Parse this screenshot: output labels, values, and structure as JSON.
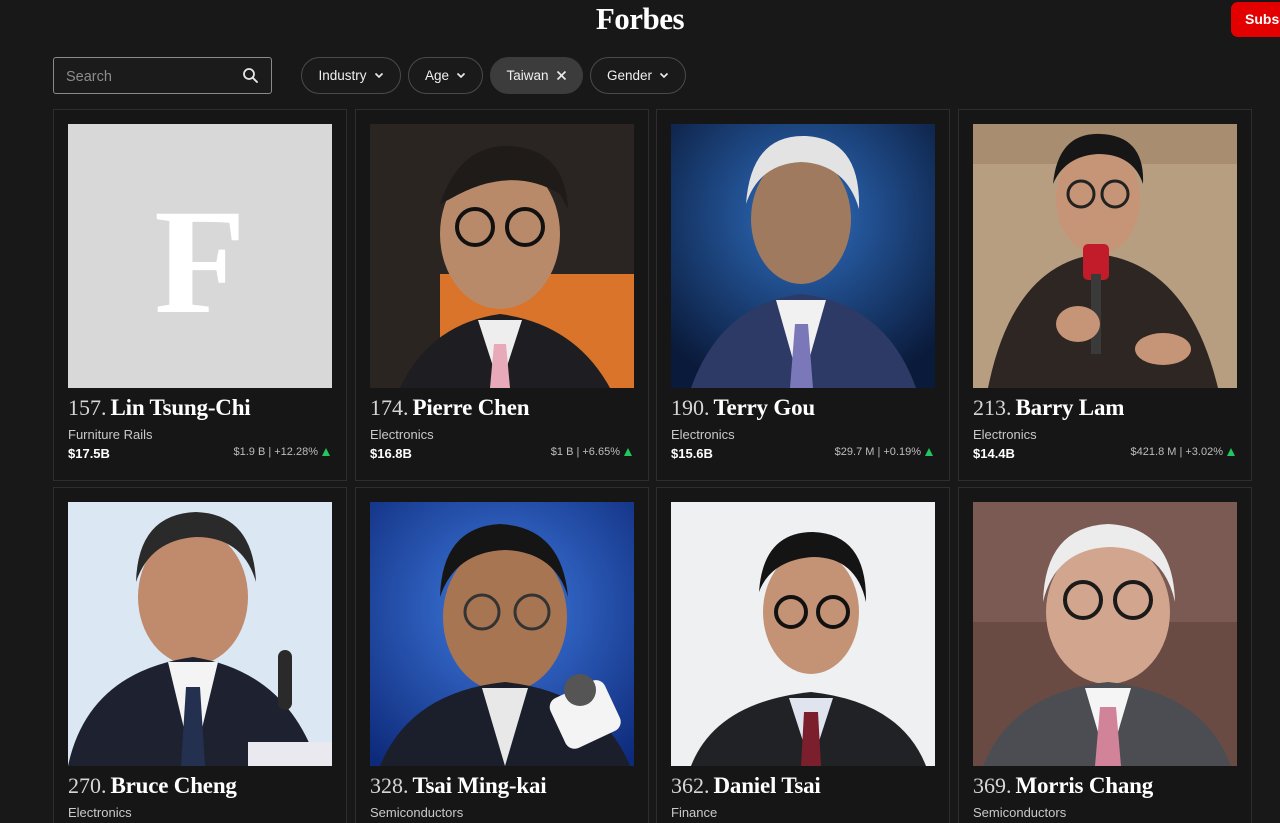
{
  "header": {
    "logo": "Forbes",
    "subscribe_label": "Subsc"
  },
  "filters": {
    "search_placeholder": "Search",
    "industry_label": "Industry",
    "age_label": "Age",
    "country_label": "Taiwan",
    "gender_label": "Gender"
  },
  "people": [
    {
      "rank": "157.",
      "name": "Lin Tsung-Chi",
      "industry": "Furniture Rails",
      "net_worth": "$17.5B",
      "change": "$1.9 B | +12.28%"
    },
    {
      "rank": "174.",
      "name": "Pierre Chen",
      "industry": "Electronics",
      "net_worth": "$16.8B",
      "change": "$1 B | +6.65%"
    },
    {
      "rank": "190.",
      "name": "Terry Gou",
      "industry": "Electronics",
      "net_worth": "$15.6B",
      "change": "$29.7 M | +0.19%"
    },
    {
      "rank": "213.",
      "name": "Barry Lam",
      "industry": "Electronics",
      "net_worth": "$14.4B",
      "change": "$421.8 M | +3.02%"
    },
    {
      "rank": "270.",
      "name": "Bruce Cheng",
      "industry": "Electronics",
      "net_worth": "",
      "change": ""
    },
    {
      "rank": "328.",
      "name": "Tsai Ming-kai",
      "industry": "Semiconductors",
      "net_worth": "",
      "change": ""
    },
    {
      "rank": "362.",
      "name": "Daniel Tsai",
      "industry": "Finance",
      "net_worth": "",
      "change": ""
    },
    {
      "rank": "369.",
      "name": "Morris Chang",
      "industry": "Semiconductors",
      "net_worth": "",
      "change": ""
    }
  ],
  "placeholder_photo": {
    "letter": "F"
  },
  "colors": {
    "background": "#181818",
    "subscribe": "#e30000",
    "trend_up": "#22c55e"
  }
}
